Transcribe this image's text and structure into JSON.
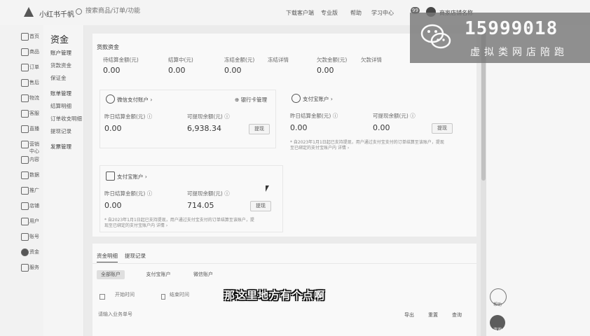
{
  "colors": {
    "accent": "#4a4a4a",
    "background": "#f1f1f1",
    "card": "#ffffff",
    "watermark_bg": "#787878"
  },
  "header": {
    "app_name": "小红书千帆",
    "search_placeholder": "搜索商品/订单/功能",
    "links": [
      "下载客户端",
      "专业版",
      "帮助",
      "学习中心"
    ],
    "message_count": "99",
    "shop_name": "商家店铺名称"
  },
  "sidebar": {
    "items": [
      {
        "label": "首页",
        "icon": "home-icon"
      },
      {
        "label": "商品",
        "icon": "product-icon"
      },
      {
        "label": "订单",
        "icon": "order-icon"
      },
      {
        "label": "售后",
        "icon": "aftersale-icon"
      },
      {
        "label": "物流",
        "icon": "logistics-icon"
      },
      {
        "label": "客服",
        "icon": "service-icon"
      },
      {
        "label": "直播",
        "icon": "live-icon"
      },
      {
        "label": "营销中心",
        "icon": "marketing-icon"
      },
      {
        "label": "内容",
        "icon": "content-icon"
      },
      {
        "label": "数据",
        "icon": "data-icon"
      },
      {
        "label": "推广",
        "icon": "promo-icon"
      },
      {
        "label": "店铺",
        "icon": "store-icon"
      },
      {
        "label": "用户",
        "icon": "user-icon"
      },
      {
        "label": "账号",
        "icon": "account-icon"
      },
      {
        "label": "资金",
        "icon": "wallet-icon"
      },
      {
        "label": "服务",
        "icon": "service-market-icon"
      }
    ],
    "active_label": "资金"
  },
  "subnav": {
    "title": "资金",
    "items": [
      "账户管理",
      "货款资金",
      "保证金",
      "账单管理",
      "结算明细",
      "订单收支明细",
      "提现记录",
      "发票管理"
    ]
  },
  "overview": {
    "title": "货款资金",
    "stats": [
      {
        "label": "待结算金额(元)",
        "value": "0.00"
      },
      {
        "label": "结算中(元)",
        "value": "0.00"
      },
      {
        "label": "冻结金额(元)",
        "value": "0.00"
      },
      {
        "label": "冻结详情",
        "value": ""
      },
      {
        "label": "欠款金额(元)",
        "value": "0.00"
      },
      {
        "label": "欠款详情",
        "value": ""
      }
    ]
  },
  "accounts": [
    {
      "name": "微信支付账户 ›",
      "action": "⊕ 银行卡管理",
      "yesterday_label": "昨日结算金额(元) ⓘ",
      "yesterday_value": "0.00",
      "available_label": "可提现余额(元) ⓘ",
      "available_value": "6,938.34",
      "button": "提现",
      "note": ""
    },
    {
      "name": "支付宝账户 ›",
      "action": "",
      "yesterday_label": "昨日结算金额(元) ⓘ",
      "yesterday_value": "0.00",
      "available_label": "可提现余额(元) ⓘ",
      "available_value": "0.00",
      "button": "提现",
      "note_line1": "* 自2023年1月1日起已支持提现，用户通过支付宝支付的订单结算至该账户，提现",
      "note_line2": "至已绑定的支付宝账户内 详情 ›"
    },
    {
      "name": "支付宝账户 ›",
      "action": "",
      "yesterday_label": "昨日结算金额(元) ⓘ",
      "yesterday_value": "0.00",
      "available_label": "可提现余额(元) ⓘ",
      "available_value": "714.05",
      "button": "提现",
      "note_line1": "* 自2023年1月1日起已支持提现，用户通过支付宝支付的订单结算至该账户，提",
      "note_line2": "现至已绑定的支付宝账户内 详情 ›"
    }
  ],
  "records": {
    "tabs": [
      "资金明细",
      "提现记录"
    ],
    "filters": [
      "全部账户",
      "支付宝账户",
      "微信账户"
    ],
    "date_start_placeholder": "开始时间",
    "date_end_placeholder": "结束时间",
    "order_placeholder": "请输入业务单号",
    "actions": [
      "导出",
      "重置",
      "查询"
    ]
  },
  "watermark": {
    "number": "15999018",
    "text": "虚拟类网店陪跑"
  },
  "right_buttons": [
    {
      "label": "帮助",
      "icon": "help-icon"
    },
    {
      "label": "咨询",
      "icon": "chat-icon"
    }
  ],
  "subtitle": "那这里地方有个点啊"
}
